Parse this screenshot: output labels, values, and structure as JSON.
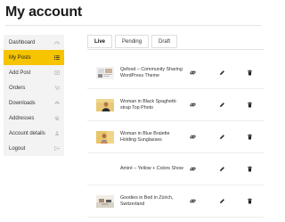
{
  "page": {
    "title": "My account"
  },
  "sidebar": {
    "items": [
      {
        "label": "Dashboard",
        "icon": "dashboard-icon"
      },
      {
        "label": "My Posts",
        "icon": "posts-list-icon",
        "active": true
      },
      {
        "label": "Add Post",
        "icon": "add-post-icon"
      },
      {
        "label": "Orders",
        "icon": "orders-icon"
      },
      {
        "label": "Downloads",
        "icon": "download-icon"
      },
      {
        "label": "Addresses",
        "icon": "home-icon"
      },
      {
        "label": "Account details",
        "icon": "user-icon"
      },
      {
        "label": "Logout",
        "icon": "logout-icon"
      }
    ],
    "active_color": "#f6c400"
  },
  "tabs": [
    {
      "label": "Live",
      "active": true
    },
    {
      "label": "Pending"
    },
    {
      "label": "Draft"
    }
  ],
  "posts": [
    {
      "title": "Qefood – Community Sharing WordPress Theme"
    },
    {
      "title": "Woman in Black Spaghetti-strap Top Photo"
    },
    {
      "title": "Woman in Blue Bralette Holding Sunglasses"
    },
    {
      "title": "Amiré – Yellow + Colors Show"
    },
    {
      "title": "Goodies in Bed in Zürich, Switzerland"
    }
  ]
}
